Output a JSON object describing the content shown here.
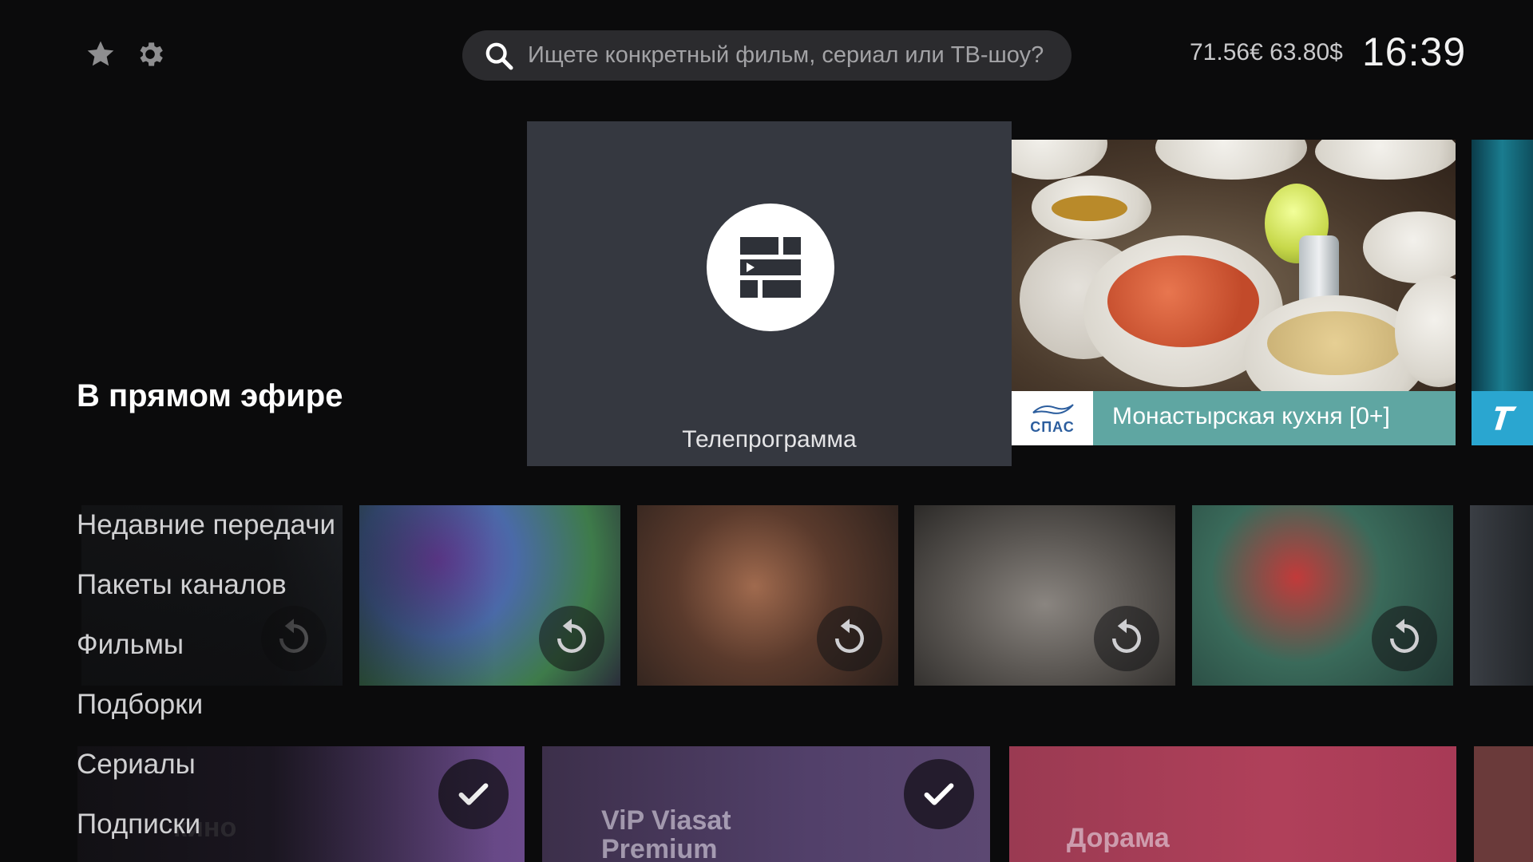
{
  "header": {
    "favorites_icon": "star-icon",
    "settings_icon": "gear-icon",
    "search": {
      "placeholder": "Ищете конкретный фильм, сериал или ТВ-шоу?",
      "icon": "search-icon"
    },
    "balance": "71.56€ 63.80$",
    "clock": "16:39"
  },
  "live": {
    "section_title": "В прямом эфире",
    "guide": {
      "label": "Телепрограмма",
      "icon": "tv-guide-icon"
    },
    "current": {
      "channel_logo_text": "СПАС",
      "title": "Монастырская кухня [0+]",
      "bar_color": "#5fa6a2"
    },
    "next": {
      "channel_icon": "channel-one-logo",
      "bar_color": "#2aa6d0"
    }
  },
  "menu": {
    "items": [
      "Недавние передачи",
      "Пакеты каналов",
      "Фильмы",
      "Подборки",
      "Сериалы",
      "Подписки"
    ]
  },
  "recent": {
    "replay_icon": "replay-icon",
    "count": 6
  },
  "subscriptions": {
    "items": [
      {
        "title": "кино",
        "subscribed": true
      },
      {
        "title": "ViP Viasat Premium",
        "subscribed": true
      },
      {
        "title": "Дорама",
        "subscribed": false
      }
    ],
    "check_icon": "checkmark-icon"
  },
  "colors": {
    "background": "#0b0b0c",
    "search_bg": "#2b2b2e",
    "guide_card": "#353840",
    "live_bar": "#5fa6a2",
    "dorama_card": "#b0405a"
  }
}
